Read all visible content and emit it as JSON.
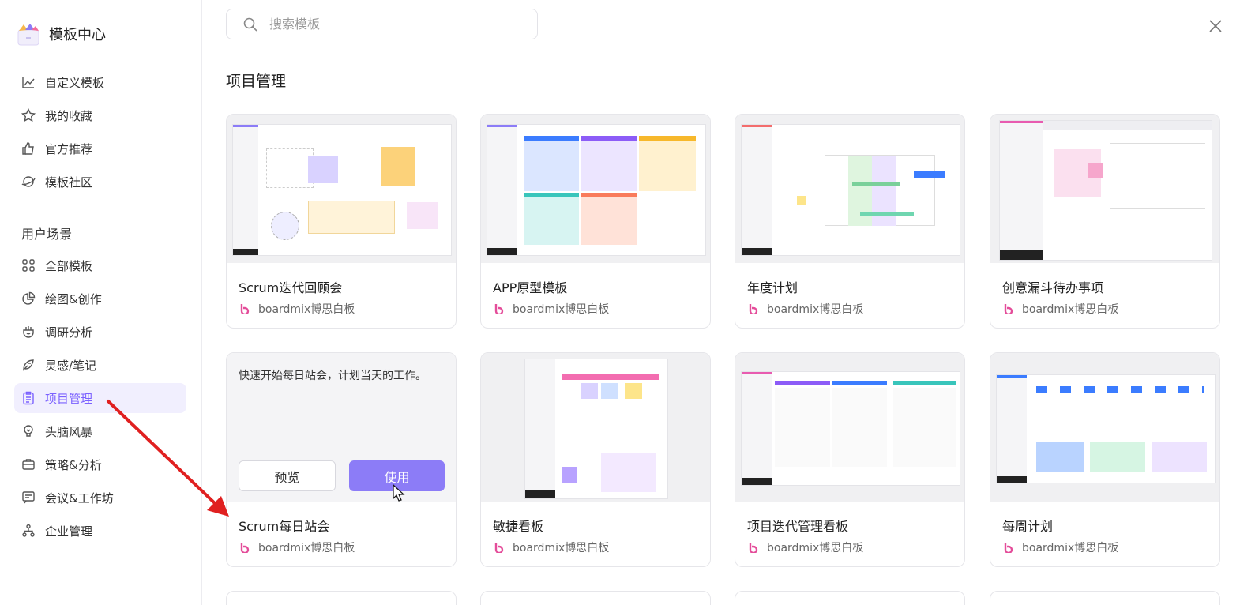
{
  "sidebar": {
    "title": "模板中心",
    "top_items": [
      {
        "label": "自定义模板",
        "icon": "chart-line-icon"
      },
      {
        "label": "我的收藏",
        "icon": "star-icon"
      },
      {
        "label": "官方推荐",
        "icon": "thumbs-up-icon"
      },
      {
        "label": "模板社区",
        "icon": "planet-icon"
      }
    ],
    "section_title": "用户场景",
    "scene_items": [
      {
        "label": "全部模板",
        "icon": "grid-icon"
      },
      {
        "label": "绘图&创作",
        "icon": "pie-chart-icon"
      },
      {
        "label": "调研分析",
        "icon": "research-icon"
      },
      {
        "label": "灵感/笔记",
        "icon": "feather-icon"
      },
      {
        "label": "项目管理",
        "icon": "clipboard-icon",
        "active": true
      },
      {
        "label": "头脑风暴",
        "icon": "bulb-icon"
      },
      {
        "label": "策略&分析",
        "icon": "briefcase-icon"
      },
      {
        "label": "会议&工作坊",
        "icon": "meeting-icon"
      },
      {
        "label": "企业管理",
        "icon": "org-chart-icon"
      }
    ]
  },
  "search": {
    "placeholder": "搜索模板"
  },
  "main": {
    "section_title": "项目管理",
    "cards": [
      {
        "title": "Scrum迭代回顾会",
        "author": "boardmix博思白板"
      },
      {
        "title": "APP原型模板",
        "author": "boardmix博思白板"
      },
      {
        "title": "年度计划",
        "author": "boardmix博思白板"
      },
      {
        "title": "创意漏斗待办事项",
        "author": "boardmix博思白板"
      },
      {
        "title": "Scrum每日站会",
        "author": "boardmix博思白板",
        "hover_description": "快速开始每日站会，计划当天的工作。",
        "preview_label": "预览",
        "use_label": "使用"
      },
      {
        "title": "敏捷看板",
        "author": "boardmix博思白板"
      },
      {
        "title": "项目迭代管理看板",
        "author": "boardmix博思白板"
      },
      {
        "title": "每周计划",
        "author": "boardmix博思白板"
      }
    ]
  },
  "colors": {
    "accent": "#7b61ff",
    "use_button": "#8c7cf7",
    "arrow": "#e02020"
  }
}
